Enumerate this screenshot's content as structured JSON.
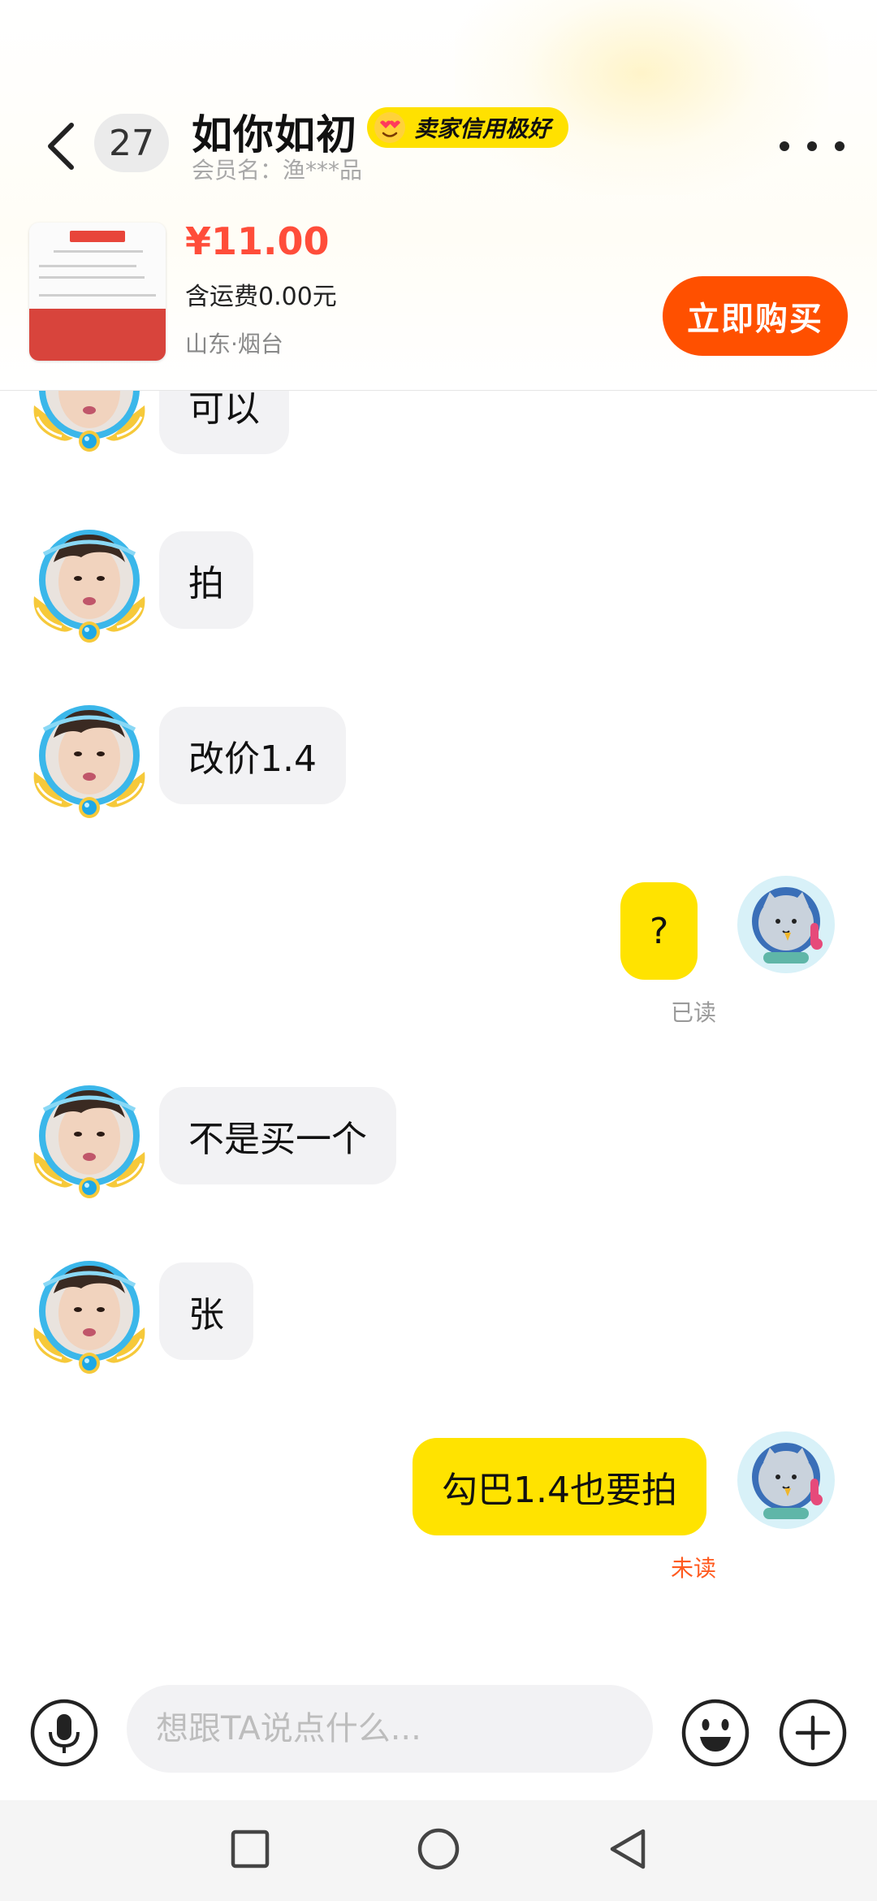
{
  "header": {
    "unread_count": "27",
    "seller_name": "如你如初",
    "seller_badge": "卖家信用极好",
    "member_name": "会员名：渔***品"
  },
  "product": {
    "price": "¥11.00",
    "shipping": "含运费0.00元",
    "location": "山东·烟台",
    "buy_label": "立即购买"
  },
  "messages": [
    {
      "side": "left",
      "text": "可以"
    },
    {
      "side": "left",
      "text": "拍"
    },
    {
      "side": "left",
      "text": "改价1.4"
    },
    {
      "side": "right",
      "text": "?",
      "status": "已读"
    },
    {
      "side": "left",
      "text": "不是买一个"
    },
    {
      "side": "left",
      "text": "张"
    },
    {
      "side": "right",
      "text": "勾巴1.4也要拍",
      "status": "未读"
    }
  ],
  "input": {
    "placeholder": "想跟TA说点什么..."
  },
  "icons": {
    "back": "chevron-left-icon",
    "more": "more-dots-icon",
    "mic": "microphone-icon",
    "emoji": "emoji-icon",
    "plus": "plus-icon",
    "nav_recent": "square-icon",
    "nav_home": "circle-icon",
    "nav_back": "triangle-back-icon"
  },
  "colors": {
    "accent_yellow": "#ffe300",
    "buy_orange": "#ff5000",
    "price_red": "#ff4d3a",
    "unread_red": "#ff5a1f",
    "read_gray": "#9a9a9a"
  }
}
